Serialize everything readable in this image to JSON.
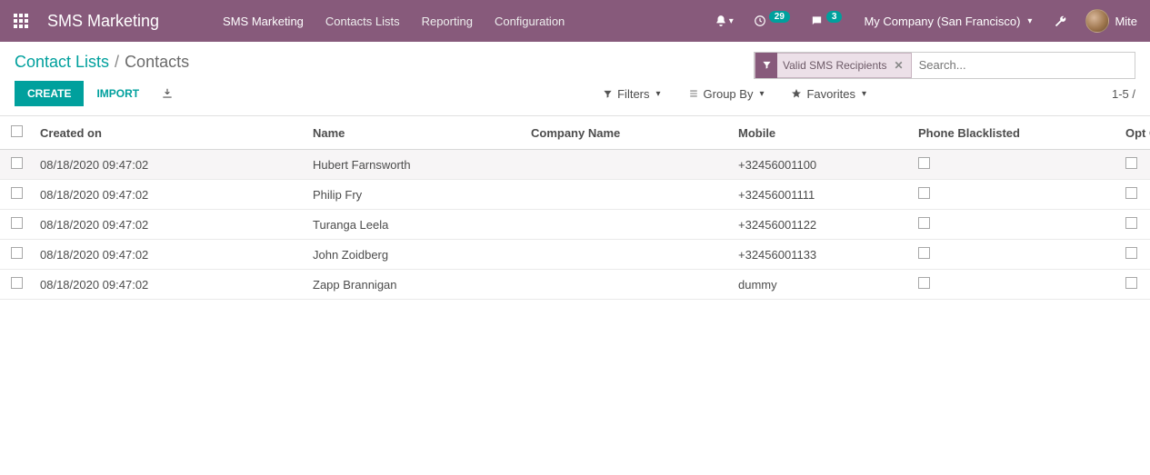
{
  "nav": {
    "brand": "SMS Marketing",
    "items": [
      "SMS Marketing",
      "Contacts Lists",
      "Reporting",
      "Configuration"
    ],
    "clock_badge": "29",
    "chat_badge": "3",
    "company": "My Company (San Francisco)",
    "user_name": "Mite"
  },
  "breadcrumb": {
    "parent": "Contact Lists",
    "sep": "/",
    "active": "Contacts"
  },
  "search": {
    "filter_tag": "Valid SMS Recipients",
    "placeholder": "Search..."
  },
  "buttons": {
    "create": "Create",
    "import": "Import"
  },
  "toolbar": {
    "filters": "Filters",
    "groupby": "Group By",
    "favorites": "Favorites",
    "counter": "1-5 /"
  },
  "table": {
    "headers": {
      "created": "Created on",
      "name": "Name",
      "company": "Company Name",
      "mobile": "Mobile",
      "blacklisted": "Phone Blacklisted",
      "optout": "Opt O"
    },
    "rows": [
      {
        "created": "08/18/2020 09:47:02",
        "name": "Hubert Farnsworth",
        "company": "",
        "mobile": "+32456001100",
        "blacklisted": false,
        "optout": false
      },
      {
        "created": "08/18/2020 09:47:02",
        "name": "Philip Fry",
        "company": "",
        "mobile": "+32456001111",
        "blacklisted": false,
        "optout": false
      },
      {
        "created": "08/18/2020 09:47:02",
        "name": "Turanga Leela",
        "company": "",
        "mobile": "+32456001122",
        "blacklisted": false,
        "optout": false
      },
      {
        "created": "08/18/2020 09:47:02",
        "name": "John Zoidberg",
        "company": "",
        "mobile": "+32456001133",
        "blacklisted": false,
        "optout": false
      },
      {
        "created": "08/18/2020 09:47:02",
        "name": "Zapp Brannigan",
        "company": "",
        "mobile": "dummy",
        "blacklisted": false,
        "optout": false
      }
    ]
  }
}
